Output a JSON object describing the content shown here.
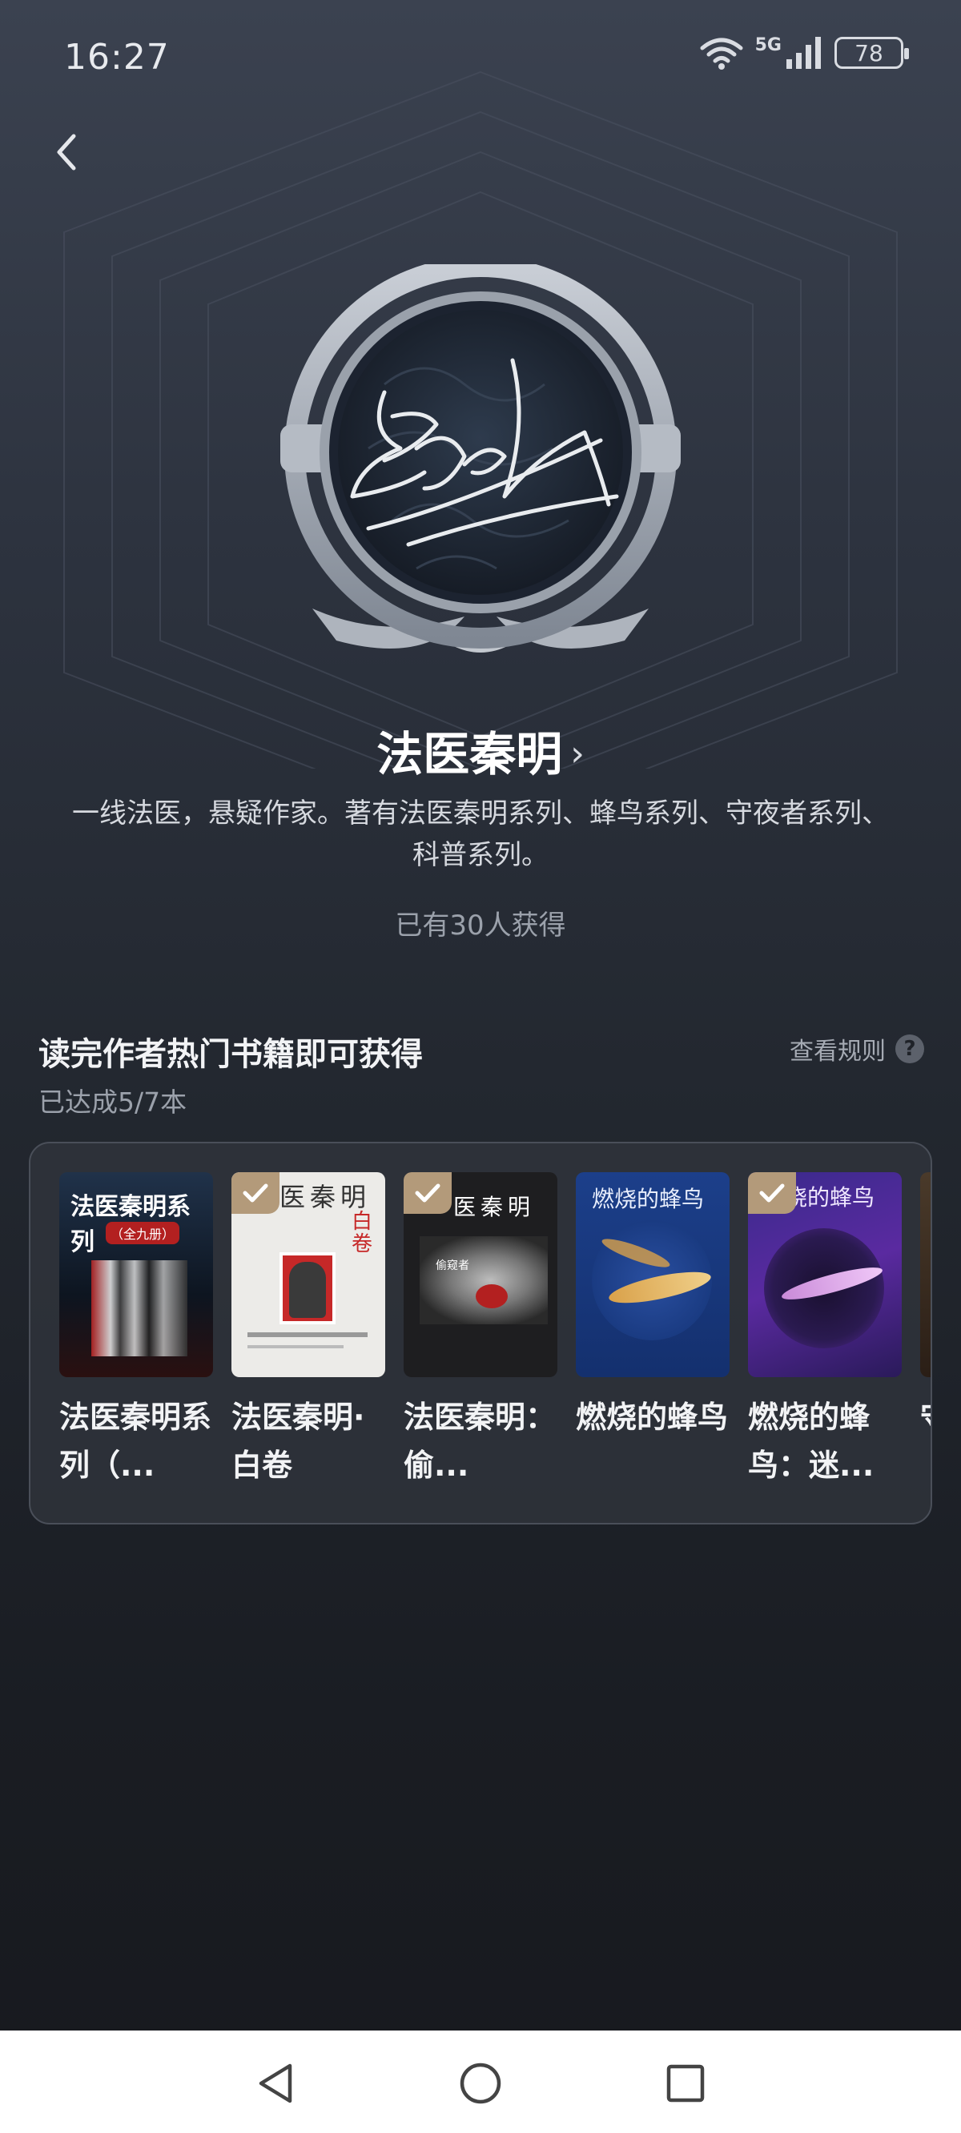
{
  "status_bar": {
    "time": "16:27",
    "network": "5G",
    "battery": "78"
  },
  "badge": {
    "signature_icon": "signature-medal-icon"
  },
  "author": {
    "name": "法医秦明",
    "description": "一线法医，悬疑作家。著有法医秦明系列、蜂鸟系列、守夜者系列、科普系列。",
    "earned_count": "已有30人获得"
  },
  "task": {
    "title": "读完作者热门书籍即可获得",
    "rules_label": "查看规则",
    "progress": "已达成5/7本"
  },
  "books": [
    {
      "title": "法医秦明系列（...",
      "cover_text": "法医秦明系列",
      "cover_sub": "（全九册）",
      "completed": false
    },
    {
      "title": "法医秦明·白卷",
      "cover_text": "医秦明",
      "cover_sub": "白卷",
      "completed": true
    },
    {
      "title": "法医秦明：偷...",
      "cover_text": "医秦明",
      "cover_sub": "偷窥者",
      "completed": true
    },
    {
      "title": "燃烧的蜂鸟",
      "cover_text": "燃烧的蜂鸟",
      "cover_sub": "",
      "completed": false
    },
    {
      "title": "燃烧的蜂鸟：迷...",
      "cover_text": "烧的蜂鸟",
      "cover_sub": "",
      "completed": true
    },
    {
      "title": "守...",
      "cover_text": "",
      "cover_sub": "",
      "completed": false
    }
  ],
  "colors": {
    "accent_check": "#b39a7a",
    "text_secondary": "#9ba1ab"
  }
}
